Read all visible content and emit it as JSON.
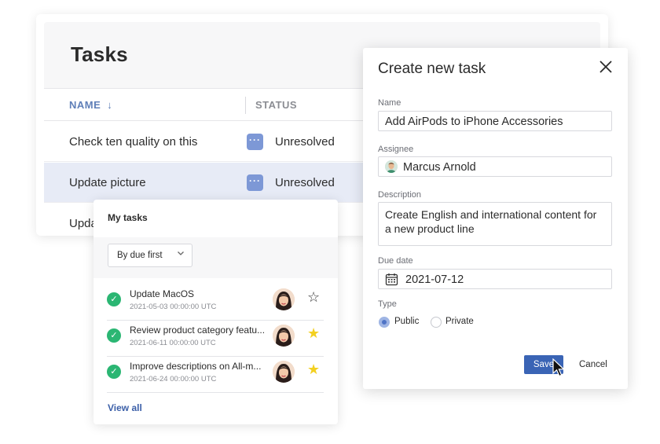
{
  "tasks": {
    "title": "Tasks",
    "columns": {
      "name": "NAME",
      "sort_arrow": "↓",
      "status": "STATUS"
    },
    "rows": [
      {
        "name": "Check ten quality on this",
        "status": "Unresolved",
        "selected": false
      },
      {
        "name": "Update picture",
        "status": "Unresolved",
        "selected": true
      },
      {
        "name": "Upda",
        "status": "",
        "selected": false
      }
    ],
    "status_icon": "ellipsis-icon"
  },
  "my_tasks": {
    "title": "My tasks",
    "filter": {
      "selected": "By due first"
    },
    "items": [
      {
        "title": "Update MacOS",
        "date": "2021-05-03  00:00:00 UTC",
        "starred": false
      },
      {
        "title": "Review product category featu...",
        "date": "2021-06-11  00:00:00 UTC",
        "starred": true
      },
      {
        "title": "Improve descriptions on All-m...",
        "date": "2021-06-24  00:00:00 UTC",
        "starred": true
      }
    ],
    "view_all": "View all",
    "colors": {
      "check": "#2bb673",
      "star": "#f3d020"
    }
  },
  "dialog": {
    "title": "Create new task",
    "name_label": "Name",
    "name_value": "Add AirPods to iPhone Accessories",
    "assignee_label": "Assignee",
    "assignee_value": "Marcus Arnold",
    "description_label": "Description",
    "description_value": "Create English and international content for a new product line",
    "due_label": "Due date",
    "due_value": "2021-07-12",
    "type_label": "Type",
    "type_options": [
      "Public",
      "Private"
    ],
    "type_selected": "Public",
    "save_label": "Save",
    "cancel_label": "Cancel",
    "accent_color": "#3a64b5"
  }
}
